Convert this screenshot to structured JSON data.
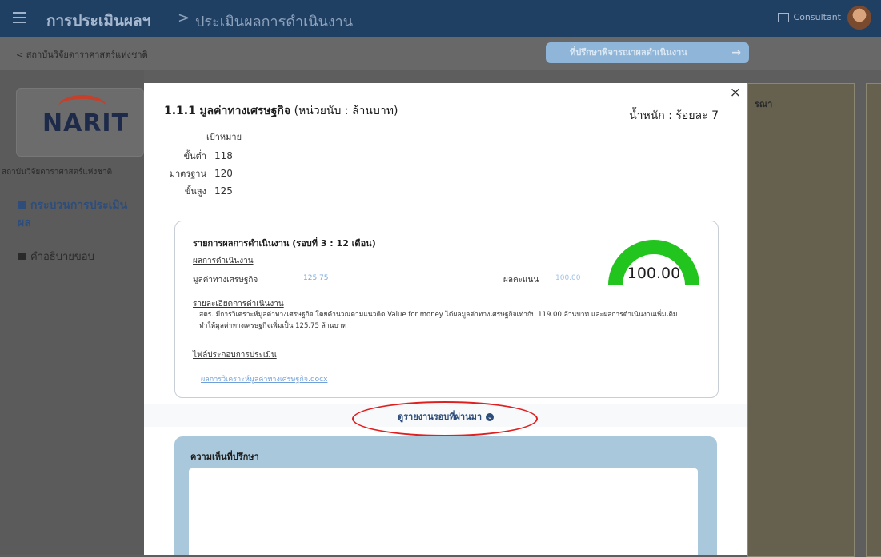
{
  "header": {
    "app_title": "การประเมินผลฯ",
    "separator": ">",
    "page_title": "ประเมินผลการดำเนินงาน",
    "role": "Consultant"
  },
  "subbar": {
    "back_label": "< สถาบันวิจัยดาราศาสตร์แห่งชาติ",
    "action_button": "ที่ปรึกษาพิจารณาผลดำเนินงาน",
    "action_arrow": "→"
  },
  "sidebar": {
    "logo_text": "NARIT",
    "org_name": "สถาบันวิจัยดาราศาสตร์แห่งชาติ",
    "nav_process": "กระบวนการประเมินผล",
    "nav_instructions": "คำอธิบายขอบ"
  },
  "right_panel": {
    "label": "รณา"
  },
  "modal": {
    "close": "×",
    "kpi_code": "1.1.1",
    "kpi_name": "มูลค่าทางเศรษฐกิจ",
    "kpi_unit": "(หน่วยนับ : ล้านบาท)",
    "weight": "น้ำหนัก : ร้อยละ 7",
    "target_heading": "เป้าหมาย",
    "targets": [
      {
        "label": "ขั้นต่ำ",
        "value": "118"
      },
      {
        "label": "มาตรฐาน",
        "value": "120"
      },
      {
        "label": "ขั้นสูง",
        "value": "125"
      }
    ],
    "report": {
      "title": "รายการผลการดำเนินงาน (รอบที่ 3 : 12 เดือน)",
      "result_heading": "ผลการดำเนินงาน",
      "result_label": "มูลค่าทางเศรษฐกิจ",
      "result_value": "125.75",
      "score_label": "ผลคะแนน",
      "score_value": "100.00",
      "gauge_value": "100.00",
      "gauge_level": 1.0,
      "gauge_color": "#22c41e",
      "detail_heading": "รายละเอียดการดำเนินงาน",
      "detail_text": "สดร. มีการวิเคราะห์มูลค่าทางเศรษฐกิจ โดยคำนวณตามแนวคิด Value for money ได้ผลมูลค่าทางเศรษฐกิจเท่ากับ 119.00 ล้านบาท และผลการดำเนินงานเพิ่มเติม ทำให้มูลค่าทางเศรษฐกิจเพิ่มเป็น 125.75 ล้านบาท",
      "attachment_heading": "ไฟล์ประกอบการประเมิน",
      "attachment_link": "ผลการวิเคราะห์มูลค่าทางเศรษฐกิจ.docx"
    },
    "history_link": "ดูรายงานรอบที่ผ่านมา",
    "history_icon": "⌄",
    "comment_title": "ความเห็นที่ปรึกษา"
  }
}
